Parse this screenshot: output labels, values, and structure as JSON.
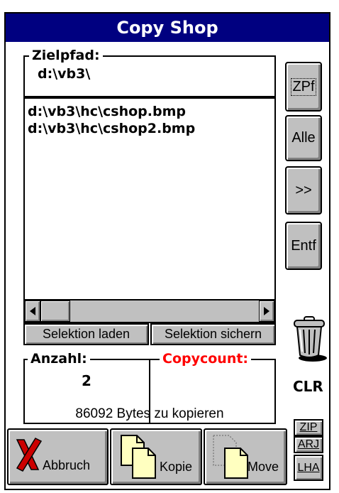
{
  "window": {
    "title": "Copy Shop"
  },
  "target": {
    "label": "Zielpfad:",
    "path": "d:\\vb3\\"
  },
  "files": [
    "d:\\vb3\\hc\\cshop.bmp",
    "d:\\vb3\\hc\\cshop2.bmp"
  ],
  "selection": {
    "load_label": "Selektion laden",
    "save_label": "Selektion sichern"
  },
  "side_buttons": {
    "zpf": "ZPf",
    "alle": "Alle",
    "move_right": ">>",
    "entf": "Entf"
  },
  "counts": {
    "anzahl_label": "Anzahl:",
    "anzahl_value": "2",
    "copycount_label": "Copycount:",
    "copycount_value": "",
    "copycount_color": "#ff0000"
  },
  "trash": {
    "label": "CLR"
  },
  "status": {
    "bytes_text": "86092 Bytes zu kopieren"
  },
  "archive": {
    "zip": "ZIP",
    "arj": "ARJ",
    "lha": "LHA"
  },
  "actions": {
    "abbruch": "Abbruch",
    "kopie": "Kopie",
    "move": "Move"
  },
  "colors": {
    "title_bar": "#000080",
    "button_face": "#c0c0c0",
    "abbruch_x": "#cc0000",
    "document": "#ffffc0"
  }
}
